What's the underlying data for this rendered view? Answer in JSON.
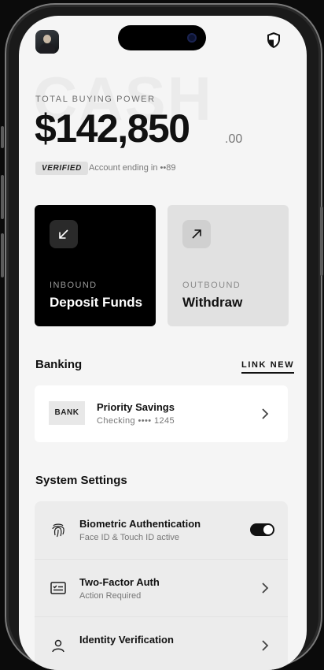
{
  "header": {
    "avatar_alt": "profile-photo",
    "security_icon": "shield-icon"
  },
  "watermark": "CASH",
  "balance": {
    "label": "TOTAL BUYING POWER",
    "amount": "$142,850",
    "cents": ".00",
    "badge": "VERIFIED",
    "account_text": "Account ending in ••89"
  },
  "actions": [
    {
      "kind": "INBOUND",
      "label": "Deposit Funds",
      "icon": "arrow-down-left-icon"
    },
    {
      "kind": "OUTBOUND",
      "label": "Withdraw",
      "icon": "arrow-up-right-icon"
    }
  ],
  "banking": {
    "title": "Banking",
    "link_label": "LINK NEW",
    "account": {
      "logo_text": "BANK",
      "name": "Priority Savings",
      "detail": "Checking •••• 1245"
    }
  },
  "settings": {
    "title": "System Settings",
    "items": [
      {
        "title": "Biometric Authentication",
        "subtitle": "Face ID & Touch ID active",
        "icon": "fingerprint-icon",
        "control": "toggle",
        "enabled": true
      },
      {
        "title": "Two-Factor Auth",
        "subtitle": "Action Required",
        "icon": "checklist-icon",
        "control": "chevron"
      },
      {
        "title": "Identity Verification",
        "subtitle": "",
        "icon": "id-icon",
        "control": "chevron"
      }
    ]
  },
  "colors": {
    "primary": "#111111",
    "background": "#f5f5f5",
    "card_dark": "#000000",
    "card_light": "#e1e1e1"
  }
}
